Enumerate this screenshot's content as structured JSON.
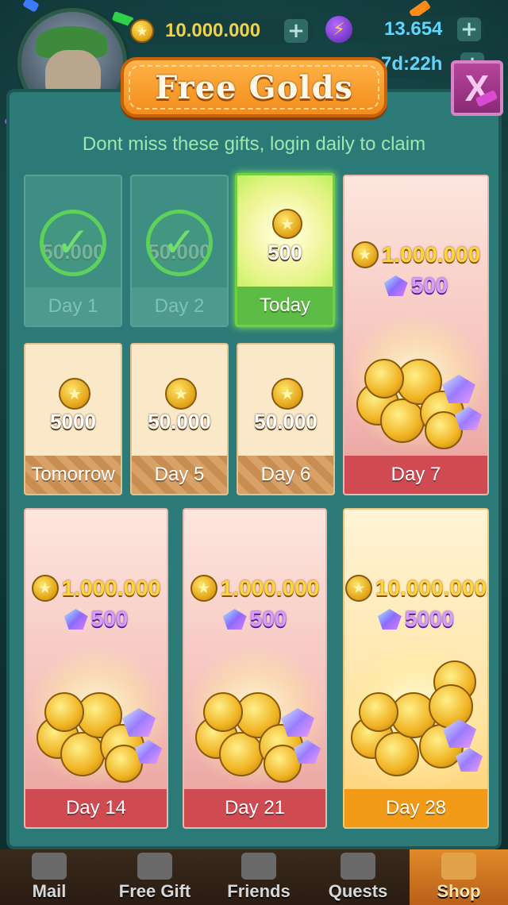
{
  "hud": {
    "coins_value": "10.000.000",
    "energy_value": "13.654",
    "timer_value": "7d:22h",
    "plus_label": "+"
  },
  "popup": {
    "title": "Free Golds",
    "close_label": "X",
    "subtitle": "Dont miss these gifts, login daily to claim"
  },
  "rewards": [
    {
      "day_label": "Day 1",
      "gold": "50.000",
      "state": "claimed"
    },
    {
      "day_label": "Day 2",
      "gold": "50.000",
      "state": "claimed"
    },
    {
      "day_label": "Today",
      "gold": "500",
      "state": "today"
    },
    {
      "day_label": "Day 7",
      "gold": "1.000.000",
      "gems": "500",
      "state": "locked"
    },
    {
      "day_label": "Tomorrow",
      "gold": "5000",
      "state": "locked"
    },
    {
      "day_label": "Day 5",
      "gold": "50.000",
      "state": "locked"
    },
    {
      "day_label": "Day 6",
      "gold": "50.000",
      "state": "locked"
    },
    {
      "day_label": "Day 14",
      "gold": "1.000.000",
      "gems": "500",
      "state": "locked"
    },
    {
      "day_label": "Day 21",
      "gold": "1.000.000",
      "gems": "500",
      "state": "locked"
    },
    {
      "day_label": "Day 28",
      "gold": "10.000.000",
      "gems": "5000",
      "state": "locked"
    }
  ],
  "nav": {
    "items": [
      {
        "label": "Mail",
        "icon": "mail-icon"
      },
      {
        "label": "Free Gift",
        "icon": "gift-icon"
      },
      {
        "label": "Friends",
        "icon": "friends-icon"
      },
      {
        "label": "Quests",
        "icon": "quests-icon"
      },
      {
        "label": "Shop",
        "icon": "shop-icon"
      }
    ]
  },
  "colors": {
    "panel": "#2c7a77",
    "banner": "#f28c1a",
    "today_border": "#6fd23c",
    "big_footer": "#d04a52",
    "day28_footer": "#f29a16"
  }
}
